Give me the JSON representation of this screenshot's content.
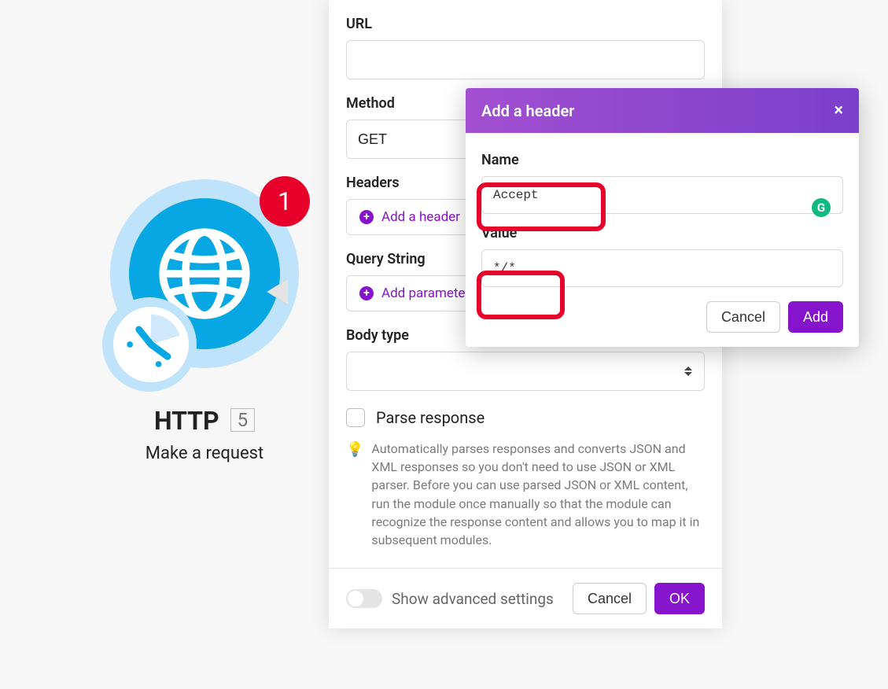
{
  "module": {
    "title": "HTTP",
    "count": "5",
    "subtitle": "Make a request",
    "badge": "1"
  },
  "form": {
    "url_label": "URL",
    "url_value": "",
    "method_label": "Method",
    "method_value": "GET",
    "headers_label": "Headers",
    "add_header_label": "Add a header",
    "query_label": "Query String",
    "add_param_label": "Add parameter",
    "body_type_label": "Body type",
    "body_type_value": "",
    "parse_response_label": "Parse response",
    "parse_response_hint": "Automatically parses responses and converts JSON and XML responses so you don't need to use JSON or XML parser. Before you can use parsed JSON or XML content, run the module once manually so that the module can recognize the response content and allows you to map it in subsequent modules."
  },
  "footer": {
    "advanced_label": "Show advanced settings",
    "cancel_label": "Cancel",
    "ok_label": "OK"
  },
  "popup": {
    "title": "Add a header",
    "name_label": "Name",
    "name_value": "Accept",
    "value_label": "Value",
    "value_value": "*/*",
    "cancel_label": "Cancel",
    "add_label": "Add"
  },
  "icons": {
    "bulb": "💡"
  }
}
